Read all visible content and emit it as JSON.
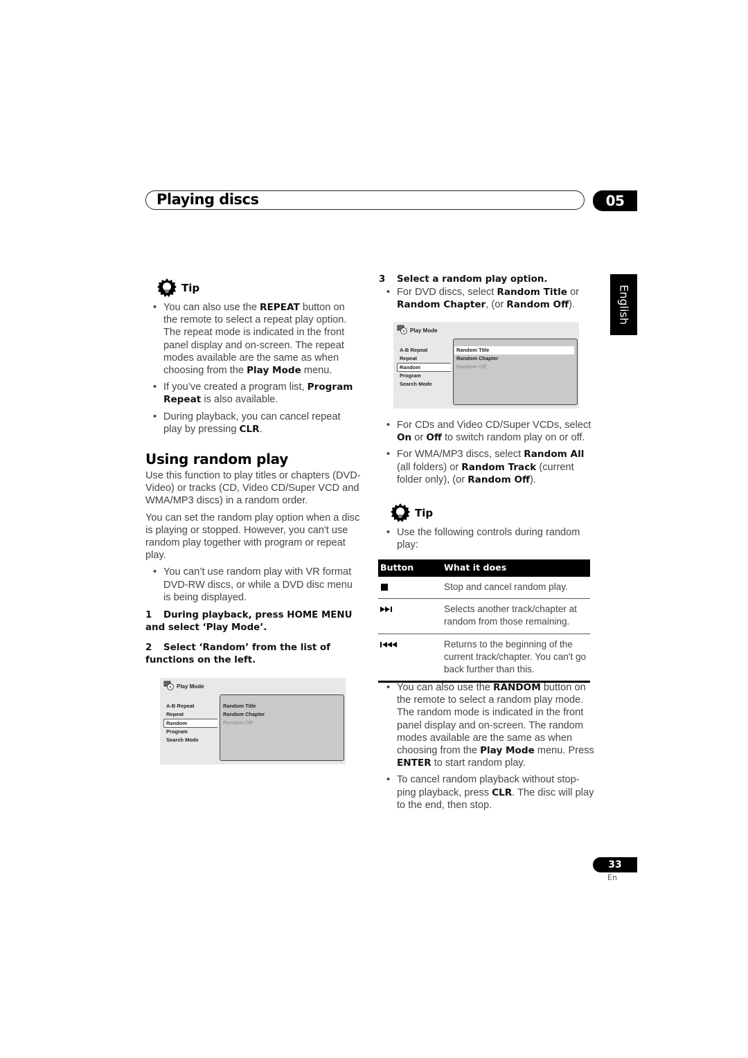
{
  "header": {
    "title": "Playing discs",
    "chapter": "05"
  },
  "side_tab": {
    "language": "English"
  },
  "left_column": {
    "tip": {
      "label": "Tip",
      "icon": "lightbulb-gear-icon",
      "bullets": [
        {
          "parts": [
            "You can also use the ",
            {
              "b": "REPEAT"
            },
            " button on the remote to select a repeat play option. The repeat mode is indicated in the front panel display and on-screen. The repeat modes available are the same as when choosing from the ",
            {
              "b": "Play Mode"
            },
            " menu."
          ]
        },
        {
          "parts": [
            "If you’ve created a program list, ",
            {
              "b": "Program Repeat"
            },
            " is also available."
          ]
        },
        {
          "parts": [
            "During playback, you can cancel repeat play by pressing ",
            {
              "b": "CLR"
            },
            "."
          ]
        }
      ]
    },
    "section_title": "Using random play",
    "paragraphs": [
      "Use this function to play titles or chapters (DVD-Video) or tracks (CD, Video CD/Super VCD and WMA/MP3 discs) in a random order.",
      "You can set the random play option when a disc is playing or stopped. However, you can't use random play together with program or repeat play."
    ],
    "note_bullet": "You can’t use random play with VR format DVD-RW discs, or while a DVD disc menu is being displayed.",
    "steps": [
      {
        "num": "1",
        "text": "During playback, press HOME MENU and select ‘Play Mode’."
      },
      {
        "num": "2",
        "text": "Select ‘Random’ from the list of functions on the left."
      }
    ],
    "screen": {
      "title": "Play Mode",
      "menu": [
        "A-B Repeat",
        "Repeat",
        "Random",
        "Program",
        "Search Mode"
      ],
      "selected_menu": "Random",
      "options": [
        "Random Title",
        "Random Chapter",
        "Random Off"
      ],
      "highlighted_option": null,
      "disabled_option": "Random Off"
    }
  },
  "right_column": {
    "step3": {
      "num": "3",
      "text": "Select a random play option."
    },
    "dvd_bullet": {
      "parts": [
        "For DVD discs, select ",
        {
          "b": "Random Title"
        },
        " or ",
        {
          "b": "Random Chapter"
        },
        ", (or ",
        {
          "b": "Random Off"
        },
        ")."
      ]
    },
    "screen": {
      "title": "Play Mode",
      "menu": [
        "A-B Repeat",
        "Repeat",
        "Random",
        "Program",
        "Search Mode"
      ],
      "selected_menu": "Random",
      "options": [
        "Random Title",
        "Random Chapter",
        "Random Off"
      ],
      "highlighted_option": "Random Title",
      "disabled_option": "Random Off"
    },
    "bullets": [
      {
        "parts": [
          "For CDs and Video CD/Super VCDs, select ",
          {
            "b": "On"
          },
          " or ",
          {
            "b": "Off"
          },
          " to switch random play on or off."
        ]
      },
      {
        "parts": [
          "For WMA/MP3 discs, select ",
          {
            "b": "Random All"
          },
          " (all folders) or ",
          {
            "b": "Random Track"
          },
          " (current folder only), (or ",
          {
            "b": "Random Off"
          },
          ")."
        ]
      }
    ],
    "tip": {
      "label": "Tip",
      "intro": "Use the following controls during random play:",
      "table": {
        "headers": [
          "Button",
          "What it does"
        ],
        "rows": [
          {
            "button_icon": "stop-icon",
            "text": "Stop and cancel random play."
          },
          {
            "button_icon": "next-track-icon",
            "text": "Selects another track/chapter at random from those remaining."
          },
          {
            "button_icon": "previous-track-icon",
            "text": "Returns to the beginning of the current track/chapter. You can't go back further than this."
          }
        ]
      },
      "bullets": [
        {
          "parts": [
            "You can also use the ",
            {
              "b": "RANDOM"
            },
            " button on the remote to select a random play mode. The random mode is indicated in the front panel display and on-screen. The random modes available are the same as when choosing from the ",
            {
              "b": "Play Mode"
            },
            " menu. Press ",
            {
              "b": "ENTER"
            },
            " to start random play."
          ]
        },
        {
          "parts": [
            "To cancel random playback without stop-ping playback, press ",
            {
              "b": "CLR"
            },
            ". The disc will play to the end, then stop."
          ]
        }
      ]
    }
  },
  "footer": {
    "page_number": "33",
    "language_code": "En"
  }
}
